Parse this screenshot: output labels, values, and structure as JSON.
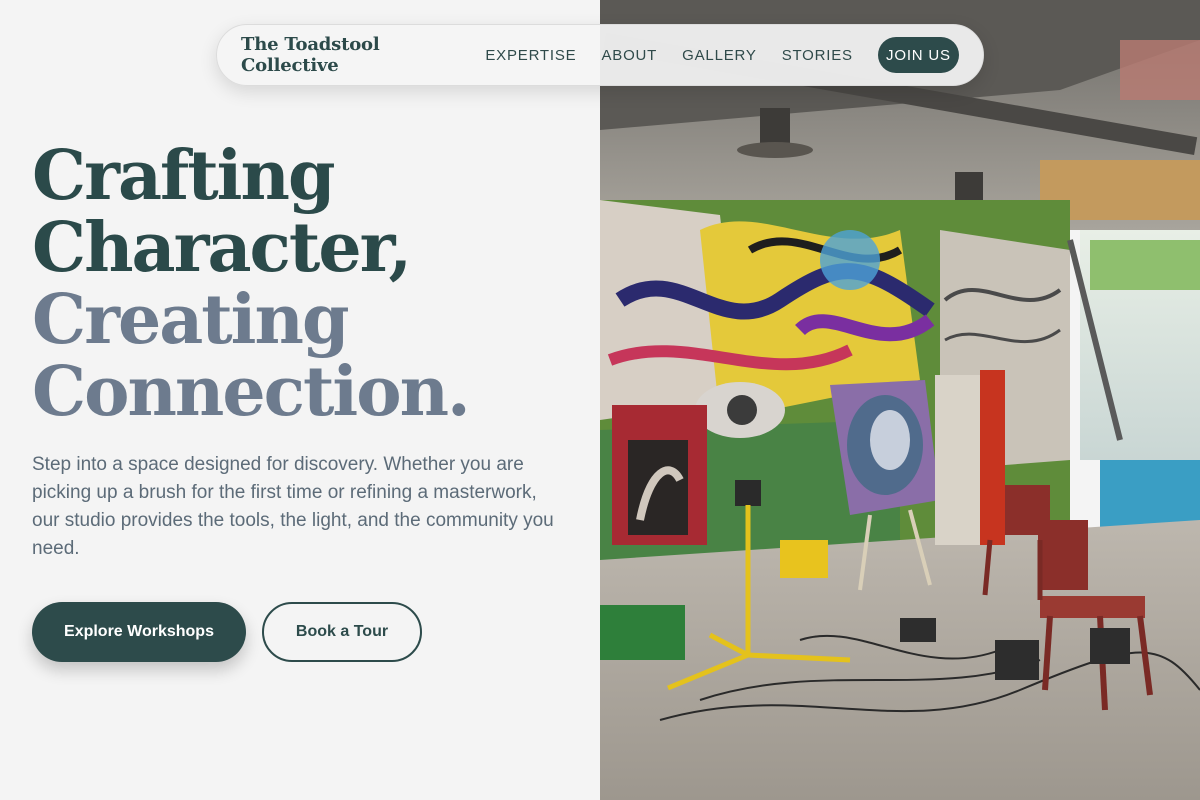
{
  "nav": {
    "brand": "The Toadstool Collective",
    "links": [
      "EXPERTISE",
      "ABOUT",
      "GALLERY",
      "STORIES"
    ],
    "cta": "JOIN US"
  },
  "hero": {
    "headline_lines": [
      "Crafting",
      "Character,",
      "Creating",
      "Connection."
    ],
    "description": "Step into a space designed for discovery. Whether you are picking up a brush for the first time or refining a masterwork, our studio provides the tools, the light, and the community you need.",
    "primary_button": "Explore Workshops",
    "secondary_button": "Book a Tour"
  },
  "colors": {
    "accent": "#2d4b4b",
    "headline_dark": "#2b4a4a",
    "headline_light": "#6d7b8e",
    "background": "#f4f4f4"
  }
}
